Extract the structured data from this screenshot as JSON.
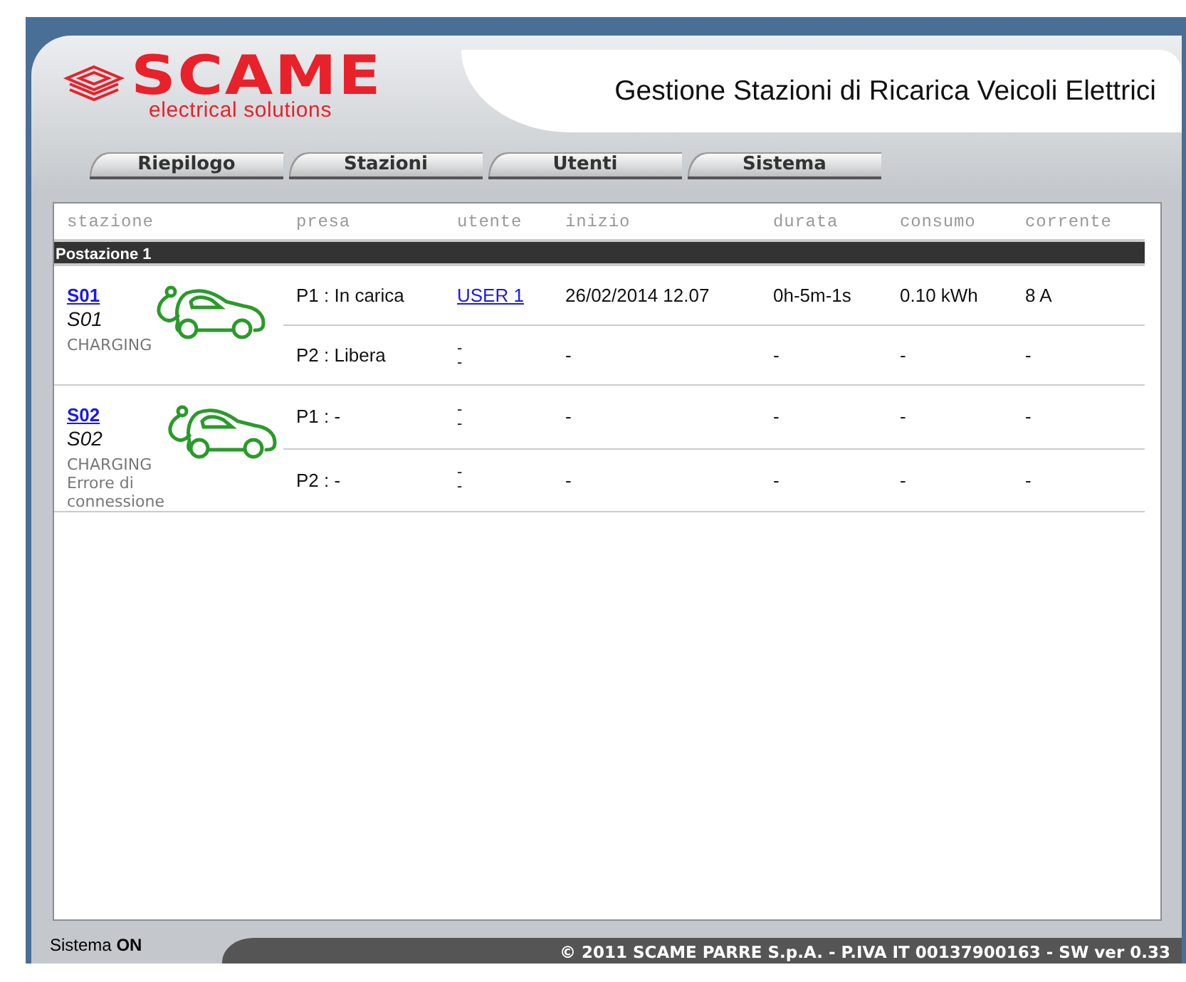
{
  "header": {
    "logo": {
      "name": "SCAME",
      "tagline": "electrical solutions"
    },
    "title": "Gestione Stazioni di Ricarica Veicoli Elettrici"
  },
  "tabs": [
    {
      "label": "Riepilogo"
    },
    {
      "label": "Stazioni"
    },
    {
      "label": "Utenti"
    },
    {
      "label": "Sistema"
    }
  ],
  "table": {
    "columns": [
      "stazione",
      "presa",
      "utente",
      "inizio",
      "durata",
      "consumo",
      "corrente"
    ],
    "groups": [
      {
        "title": "Postazione 1",
        "stations": [
          {
            "link": "S01",
            "name": "S01",
            "status": [
              "CHARGING"
            ],
            "ports": [
              {
                "presa": "P1 : In carica",
                "user": {
                  "kind": "link",
                  "lines": [
                    "USER 1"
                  ]
                },
                "inizio": "26/02/2014 12.07",
                "durata": "0h-5m-1s",
                "consumo": "0.10 kWh",
                "corrente": "8 A"
              },
              {
                "presa": "P2 : Libera",
                "user": {
                  "kind": "text",
                  "lines": [
                    "-",
                    "-"
                  ]
                },
                "inizio": "-",
                "durata": "-",
                "consumo": "-",
                "corrente": "-"
              }
            ]
          },
          {
            "link": "S02",
            "name": "S02",
            "status": [
              "CHARGING",
              "Errore di connessione"
            ],
            "ports": [
              {
                "presa": "P1 : -",
                "user": {
                  "kind": "text",
                  "lines": [
                    "-",
                    "-"
                  ]
                },
                "inizio": "-",
                "durata": "-",
                "consumo": "-",
                "corrente": "-"
              },
              {
                "presa": "P2 : -",
                "user": {
                  "kind": "text",
                  "lines": [
                    "-",
                    "-"
                  ]
                },
                "inizio": "-",
                "durata": "-",
                "consumo": "-",
                "corrente": "-"
              }
            ]
          }
        ]
      }
    ]
  },
  "footer": {
    "system_status": "Sistema **ON**",
    "copyright": "© 2011 SCAME PARRE S.p.A. - P.IVA IT 00137900163 - SW ver 0.33"
  }
}
